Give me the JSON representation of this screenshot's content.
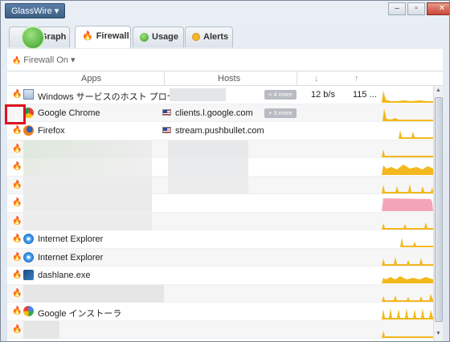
{
  "window": {
    "app_button": "GlassWire ▾",
    "controls": [
      "–",
      "▫",
      "✕"
    ]
  },
  "tabs": [
    {
      "label": "Graph",
      "icon": "globe-icon"
    },
    {
      "label": "Firewall",
      "icon": "flame-icon"
    },
    {
      "label": "Usage",
      "icon": "usage-icon"
    },
    {
      "label": "Alerts",
      "icon": "alert-icon"
    }
  ],
  "toolbar": {
    "firewall_state": "Firewall On ▾"
  },
  "table": {
    "headers": {
      "apps": "Apps",
      "hosts": "Hosts",
      "down": "↓",
      "up": "↑"
    },
    "rows": [
      {
        "app": "Windows サービスのホスト プロセス",
        "host": "",
        "more": "+ 4 more",
        "down": "12 b/s",
        "up": "115 ..."
      },
      {
        "app": "Google Chrome",
        "host": "clients.l.google.com",
        "more": "+ 3 more",
        "down": "",
        "up": ""
      },
      {
        "app": "Firefox",
        "host": "stream.pushbullet.com",
        "more": "",
        "down": "",
        "up": ""
      },
      {
        "app": "",
        "host": "",
        "more": "",
        "down": "",
        "up": ""
      },
      {
        "app": "",
        "host": "",
        "more": "",
        "down": "",
        "up": ""
      },
      {
        "app": "",
        "host": "",
        "more": "",
        "down": "",
        "up": ""
      },
      {
        "app": "",
        "host": "",
        "more": "",
        "down": "",
        "up": ""
      },
      {
        "app": "",
        "host": "",
        "more": "",
        "down": "",
        "up": ""
      },
      {
        "app": "Internet Explorer",
        "host": "",
        "more": "",
        "down": "",
        "up": ""
      },
      {
        "app": "Internet Explorer",
        "host": "",
        "more": "",
        "down": "",
        "up": ""
      },
      {
        "app": "dashlane.exe",
        "host": "",
        "more": "",
        "down": "",
        "up": ""
      },
      {
        "app": "",
        "host": "",
        "more": "",
        "down": "",
        "up": ""
      },
      {
        "app": "Google インストーラ",
        "host": "",
        "more": "",
        "down": "",
        "up": ""
      },
      {
        "app": "",
        "host": "",
        "more": "",
        "down": "",
        "up": ""
      }
    ]
  },
  "colors": {
    "spark": "#f3b81e",
    "spark_pink": "#f2a5b8",
    "highlight": "#e0101f"
  }
}
